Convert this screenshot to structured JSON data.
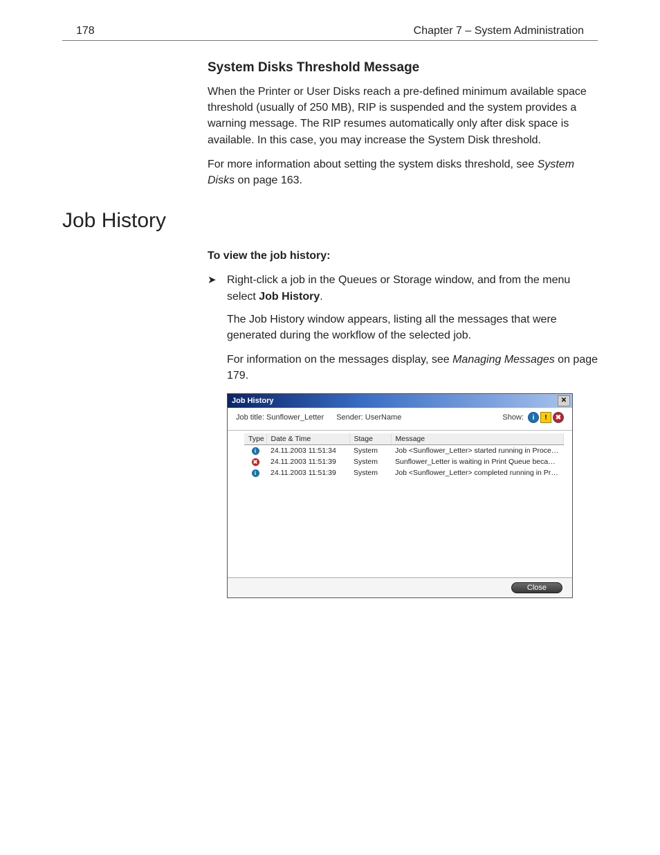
{
  "header": {
    "page_number": "178",
    "chapter_label": "Chapter 7 – System Administration"
  },
  "subsection": {
    "title": "System Disks Threshold Message",
    "p1": "When the Printer or User Disks reach a pre-defined minimum available space threshold (usually of 250 MB), RIP is suspended and the system provides a warning message. The RIP resumes automatically only after disk space is available. In this case, you may increase the System Disk threshold.",
    "p2_a": "For more information about setting the system disks threshold, see ",
    "p2_i": "System Disks",
    "p2_b": " on page 163."
  },
  "section": {
    "heading": "Job History",
    "intro_bold": "To view the job history:",
    "step1_a": "Right-click a job in the Queues or Storage window, and from the menu select ",
    "step1_bold": "Job History",
    "step1_b": ".",
    "p_after1": "The Job History window appears, listing all the messages that were generated during the workflow of the selected job.",
    "p_after2_a": "For information on the messages display, see ",
    "p_after2_i": "Managing Messages",
    "p_after2_b": " on page 179."
  },
  "dialog": {
    "title": "Job History",
    "job_title_label": "Job title: Sunflower_Letter",
    "sender_label": "Sender: UserName",
    "show_label": "Show:",
    "columns": {
      "type": "Type",
      "date": "Date & Time",
      "stage": "Stage",
      "message": "Message"
    },
    "rows": [
      {
        "icon": "info",
        "date": "24.11.2003 11:51:34",
        "stage": "System",
        "msg": "Job <Sunflower_Letter> started running in Process_Queue."
      },
      {
        "icon": "err",
        "date": "24.11.2003 11:51:39",
        "stage": "System",
        "msg": "Sunflower_Letter is waiting in Print Queue because Print Engine i..."
      },
      {
        "icon": "info",
        "date": "24.11.2003 11:51:39",
        "stage": "System",
        "msg": "Job <Sunflower_Letter> completed running in Process_Queue."
      }
    ],
    "close_label": "Close"
  }
}
